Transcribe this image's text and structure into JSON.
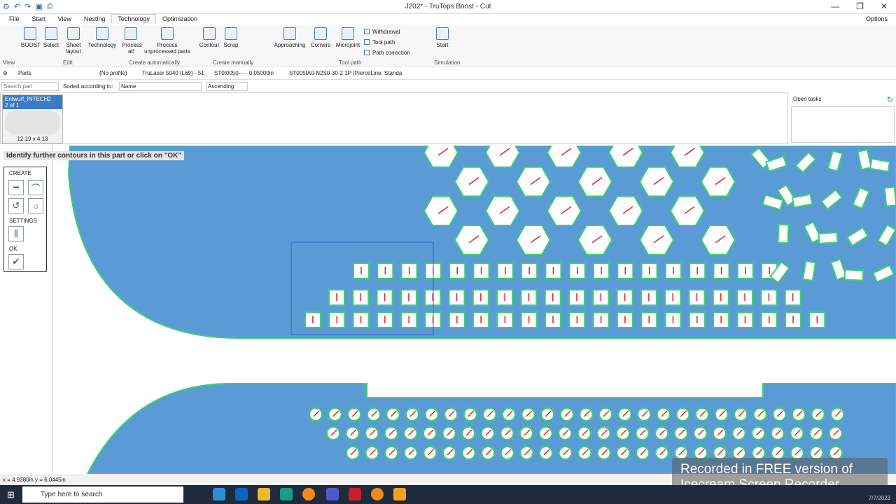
{
  "window": {
    "title": "J202* - TruTops Boost - Cut",
    "minimize": "—",
    "restore": "❐",
    "close": "✕"
  },
  "menu": {
    "tabs": [
      "File",
      "Start",
      "View",
      "Nesting",
      "Technology",
      "Optimization"
    ],
    "active": "Technology",
    "options": "Options"
  },
  "ribbon": {
    "buttons": {
      "boost": "BOOST",
      "select": "Select",
      "sheet_layout": "Sheet layout",
      "technology": "Technology",
      "process_all": "Process all",
      "process_unprocessed": "Process unprocessed parts",
      "contour": "Contour",
      "scrap": "Scrap",
      "approaching": "Approaching",
      "corners": "Corners",
      "microjoint": "Microjoint",
      "withdrawal": "Withdrawal",
      "tool_path": "Tool path",
      "path_correction": "Path correction",
      "start": "Start"
    },
    "groups": {
      "view": "View",
      "edit": "Edit",
      "create_auto": "Create automatically",
      "create_manual": "Create manually",
      "tool_path": "Tool path",
      "simulation": "Simulation"
    }
  },
  "toolbar2": {
    "parts": "Parts",
    "profile": "(No profile)",
    "machine": "TruLaser 5040 (L69) - 51",
    "material": "ST0I0050--- - 0.05000in",
    "parameter": "ST005IA0-N2S0-30-2 1P (PierceLine: Standa"
  },
  "sortbar": {
    "search_placeholder": "Search part",
    "sorted_label": "Sorted according to:",
    "sort_field": "Name",
    "sort_order": "Ascending"
  },
  "part": {
    "name": "Entwurf_INTECH2",
    "count": "2 of 1",
    "size": "12.19 x 4.13"
  },
  "open_tasks": {
    "title": "Open tasks"
  },
  "canvas": {
    "hint": "Identify further contours in this part or click on \"OK\"",
    "panel": {
      "create": "CREATE",
      "settings": "SETTINGS",
      "ok": "OK"
    },
    "colors": {
      "sheet": "#5b9bd5",
      "edge": "#3ad070",
      "path": "#e02020"
    }
  },
  "status": {
    "coords": "x = 4.9380in  y = 6.0445in"
  },
  "watermark": {
    "line1": "Recorded in FREE version of",
    "line2": "Icecream Screen Recorder"
  },
  "taskbar": {
    "search": "Type here to search",
    "date": "7/7/2023"
  }
}
